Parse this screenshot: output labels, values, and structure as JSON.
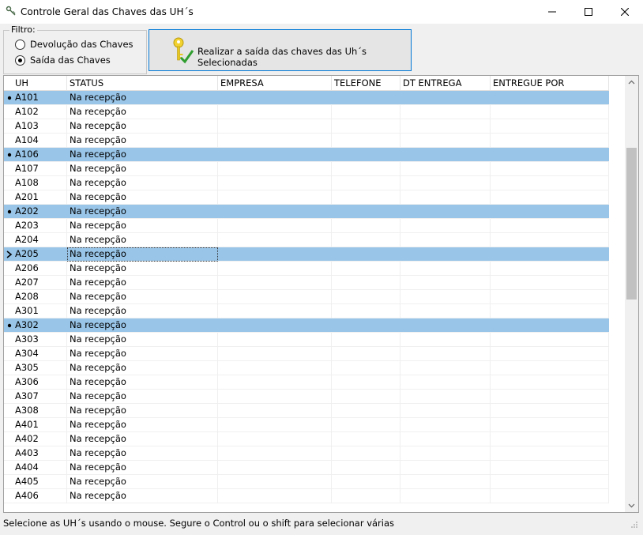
{
  "window": {
    "title": "Controle Geral das Chaves das UH´s"
  },
  "filter": {
    "legend": "Filtro:",
    "options": [
      {
        "label": "Devolução das Chaves",
        "checked": false
      },
      {
        "label": "Saída das Chaves",
        "checked": true
      }
    ]
  },
  "action_button": {
    "label": "Realizar a saída das chaves das Uh´s Selecionadas",
    "icon": "keys-check-icon"
  },
  "table": {
    "columns": [
      "UH",
      "STATUS",
      "EMPRESA",
      "TELEFONE",
      "DT ENTREGA",
      "ENTREGUE POR"
    ],
    "rows": [
      {
        "uh": "A101",
        "status": "Na recepção",
        "selected": true,
        "current": false
      },
      {
        "uh": "A102",
        "status": "Na recepção",
        "selected": false,
        "current": false
      },
      {
        "uh": "A103",
        "status": "Na recepção",
        "selected": false,
        "current": false
      },
      {
        "uh": "A104",
        "status": "Na recepção",
        "selected": false,
        "current": false
      },
      {
        "uh": "A106",
        "status": "Na recepção",
        "selected": true,
        "current": false
      },
      {
        "uh": "A107",
        "status": "Na recepção",
        "selected": false,
        "current": false
      },
      {
        "uh": "A108",
        "status": "Na recepção",
        "selected": false,
        "current": false
      },
      {
        "uh": "A201",
        "status": "Na recepção",
        "selected": false,
        "current": false
      },
      {
        "uh": "A202",
        "status": "Na recepção",
        "selected": true,
        "current": false
      },
      {
        "uh": "A203",
        "status": "Na recepção",
        "selected": false,
        "current": false
      },
      {
        "uh": "A204",
        "status": "Na recepção",
        "selected": false,
        "current": false
      },
      {
        "uh": "A205",
        "status": "Na recepção",
        "selected": true,
        "current": true
      },
      {
        "uh": "A206",
        "status": "Na recepção",
        "selected": false,
        "current": false
      },
      {
        "uh": "A207",
        "status": "Na recepção",
        "selected": false,
        "current": false
      },
      {
        "uh": "A208",
        "status": "Na recepção",
        "selected": false,
        "current": false
      },
      {
        "uh": "A301",
        "status": "Na recepção",
        "selected": false,
        "current": false
      },
      {
        "uh": "A302",
        "status": "Na recepção",
        "selected": true,
        "current": false
      },
      {
        "uh": "A303",
        "status": "Na recepção",
        "selected": false,
        "current": false
      },
      {
        "uh": "A304",
        "status": "Na recepção",
        "selected": false,
        "current": false
      },
      {
        "uh": "A305",
        "status": "Na recepção",
        "selected": false,
        "current": false
      },
      {
        "uh": "A306",
        "status": "Na recepção",
        "selected": false,
        "current": false
      },
      {
        "uh": "A307",
        "status": "Na recepção",
        "selected": false,
        "current": false
      },
      {
        "uh": "A308",
        "status": "Na recepção",
        "selected": false,
        "current": false
      },
      {
        "uh": "A401",
        "status": "Na recepção",
        "selected": false,
        "current": false
      },
      {
        "uh": "A402",
        "status": "Na recepção",
        "selected": false,
        "current": false
      },
      {
        "uh": "A403",
        "status": "Na recepção",
        "selected": false,
        "current": false
      },
      {
        "uh": "A404",
        "status": "Na recepção",
        "selected": false,
        "current": false
      },
      {
        "uh": "A405",
        "status": "Na recepção",
        "selected": false,
        "current": false
      },
      {
        "uh": "A406",
        "status": "Na recepção",
        "selected": false,
        "current": false
      }
    ]
  },
  "status_bar": {
    "text": "Selecione as UH´s usando o mouse. Segure o Control ou o shift para selecionar várias"
  },
  "colors": {
    "selection": "#99c5e8",
    "button_border": "#0078d7"
  }
}
